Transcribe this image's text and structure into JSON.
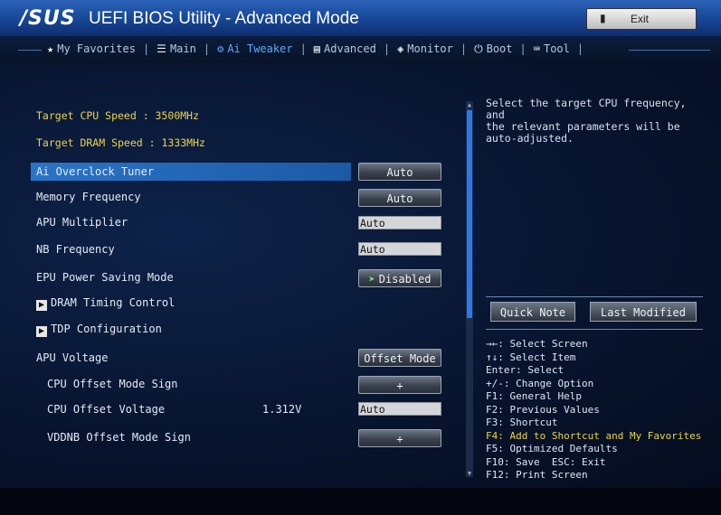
{
  "header": {
    "logo": "/SUS",
    "title": "UEFI BIOS Utility - Advanced Mode",
    "exit_label": "Exit"
  },
  "tabs": [
    {
      "icon": "star-icon",
      "glyph": "★",
      "label": "My Favorites"
    },
    {
      "icon": "list-icon",
      "glyph": "☰",
      "label": "Main"
    },
    {
      "icon": "ai-tweaker-icon",
      "glyph": "⚙",
      "label": "Ai Tweaker",
      "active": true
    },
    {
      "icon": "advanced-icon",
      "glyph": "▤",
      "label": "Advanced"
    },
    {
      "icon": "monitor-icon",
      "glyph": "◈",
      "label": "Monitor"
    },
    {
      "icon": "power-icon",
      "glyph": "⏻",
      "label": "Boot"
    },
    {
      "icon": "tool-icon",
      "glyph": "⌨",
      "label": "Tool"
    }
  ],
  "info": {
    "target_cpu": "Target CPU Speed : 3500MHz",
    "target_dram": "Target DRAM Speed : 1333MHz"
  },
  "settings": {
    "ai_overclock_tuner": {
      "label": "Ai Overclock Tuner",
      "value": "Auto"
    },
    "memory_frequency": {
      "label": "Memory Frequency",
      "value": "Auto"
    },
    "apu_multiplier": {
      "label": "APU Multiplier",
      "value": "Auto"
    },
    "nb_frequency": {
      "label": "NB Frequency",
      "value": "Auto"
    },
    "epu_power_saving": {
      "label": "EPU Power Saving Mode",
      "value": "Disabled"
    },
    "dram_timing": {
      "label": "DRAM Timing Control"
    },
    "tdp_config": {
      "label": "TDP Configuration"
    },
    "apu_voltage": {
      "label": "APU Voltage",
      "value": "Offset Mode"
    },
    "cpu_offset_sign": {
      "label": "CPU Offset Mode Sign",
      "value": "+"
    },
    "cpu_offset_voltage": {
      "label": "CPU Offset Voltage",
      "reading": "1.312V",
      "value": "Auto"
    },
    "vddnb_offset_sign": {
      "label": "VDDNB Offset Mode Sign",
      "value": "+"
    }
  },
  "help": {
    "text": "Select the target CPU frequency, and\nthe relevant parameters will be\nauto-adjusted.",
    "quick_note": "Quick Note",
    "last_modified": "Last Modified"
  },
  "keys": {
    "k1": "→←: Select Screen",
    "k2": "↑↓: Select Item",
    "k3": "Enter: Select",
    "k4": "+/-: Change Option",
    "k5": "F1: General Help",
    "k6": "F2: Previous Values",
    "k7": "F3: Shortcut",
    "k8": "F4: Add to Shortcut and My Favorites",
    "k9": "F5: Optimized Defaults",
    "k10": "F10: Save  ESC: Exit",
    "k11": "F12: Print Screen"
  },
  "colors": {
    "accent": "#2d78e8",
    "highlight": "#e8d44d",
    "background": "#081530"
  }
}
